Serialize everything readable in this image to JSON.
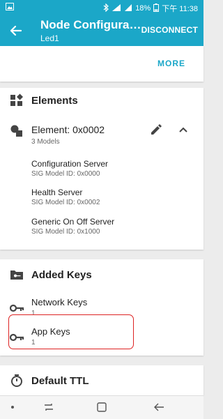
{
  "status": {
    "left_icon": "image-icon",
    "battery": "18%",
    "time": "下午 11:38"
  },
  "appbar": {
    "title": "Node Configurati…",
    "subtitle": "Led1",
    "action": "DISCONNECT"
  },
  "top_card": {
    "more": "MORE"
  },
  "elements_card": {
    "title": "Elements",
    "element": {
      "name": "Element: 0x0002",
      "count": "3 Models"
    },
    "models": [
      {
        "name": "Configuration Server",
        "id": "SIG Model ID: 0x0000"
      },
      {
        "name": "Health Server",
        "id": "SIG Model ID: 0x0002"
      },
      {
        "name": "Generic On Off Server",
        "id": "SIG Model ID: 0x1000"
      }
    ]
  },
  "keys_card": {
    "title": "Added Keys",
    "keys": [
      {
        "name": "Network Keys",
        "count": "1"
      },
      {
        "name": "App Keys",
        "count": "1"
      }
    ]
  },
  "ttl_card": {
    "title": "Default TTL"
  },
  "colors": {
    "primary": "#1ba7c8",
    "highlight": "#dd2222"
  }
}
